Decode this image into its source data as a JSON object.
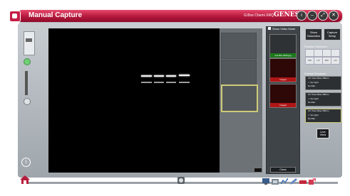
{
  "app": {
    "title": "Manual Capture",
    "model": "G:Box Chemi XRQ",
    "brand": "GENESys",
    "window_buttons": [
      "i",
      "–",
      "⤢",
      "✕"
    ]
  },
  "viewer": {
    "tool_label": ""
  },
  "gallery": {
    "check_label": "Show Video Mode",
    "thumbs": [
      {
        "footer": "Gel Blot 2006.jpg",
        "color": "#1c7a1c"
      },
      {
        "footer": "Image1",
        "color": "#b01616"
      },
      {
        "footer": "Image2",
        "color": "#b01616"
      }
    ],
    "clear_label": "Clear"
  },
  "right_panel": {
    "show_saturation": [
      "Show",
      "Saturation"
    ],
    "capture_setup": [
      "Capture",
      "Setup"
    ],
    "filter_label": "Position Selection",
    "filters": [
      "",
      "",
      "",
      "",
      "SW",
      "UV",
      "EPI",
      "UV"
    ],
    "product_label": "Current Products",
    "products": [
      [
        "UV Trans Blue 365nm",
        "✓ No Light",
        "  No filter"
      ],
      [
        "UV Trans Blue 365nm",
        "✓ No Light",
        "  No filter"
      ],
      [
        "UV Trans Blue 365nm",
        "✓ No Light",
        "  No filter"
      ]
    ],
    "live_view": [
      "Live",
      "View"
    ]
  },
  "icons": {
    "home": "home-icon",
    "center": "camera-icon",
    "tools": [
      "monitor-icon",
      "gallery-icon",
      "measure-icon",
      "edit-icon",
      "print-icon",
      "export-icon"
    ]
  }
}
